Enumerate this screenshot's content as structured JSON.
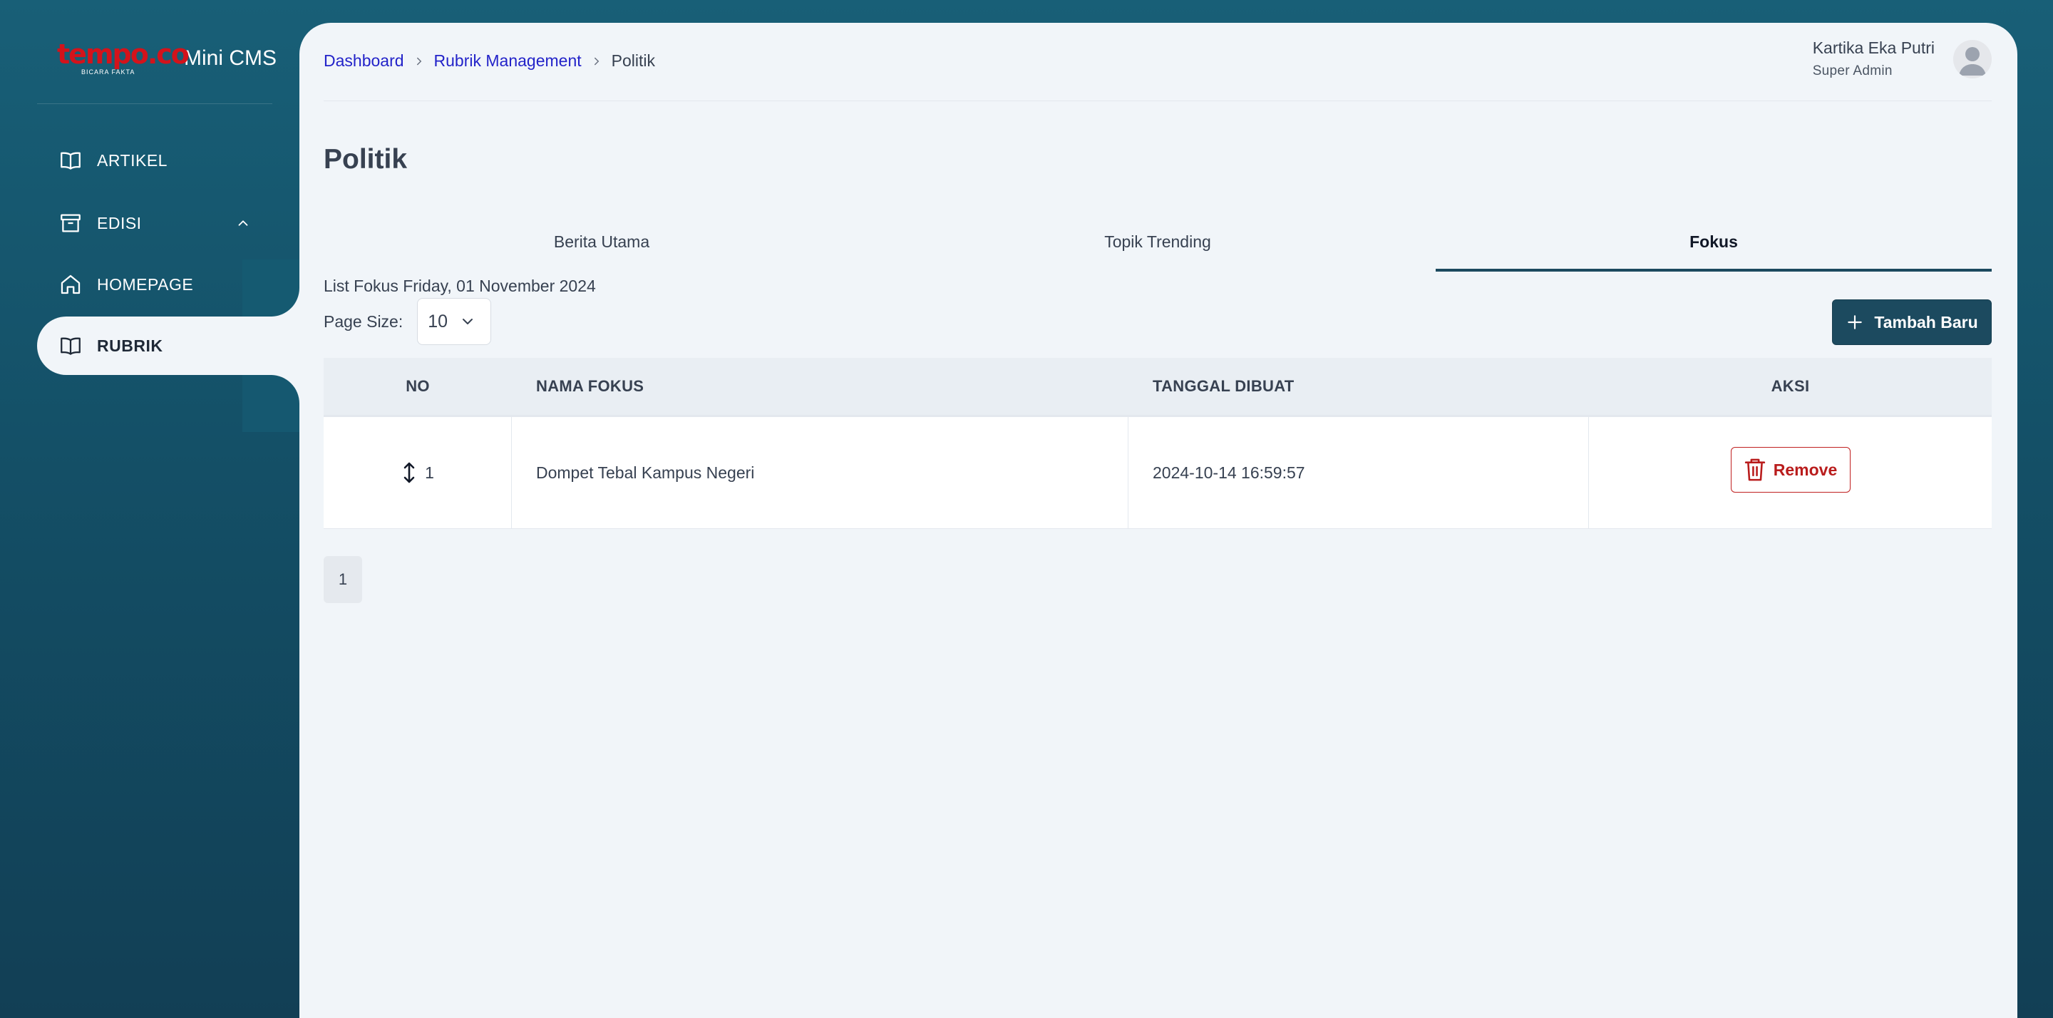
{
  "brand": {
    "logo_text": "tempo.co",
    "logo_tagline": "BICARA FAKTA",
    "app_name": "Mini CMS"
  },
  "sidebar": {
    "items": [
      {
        "label": "ARTIKEL",
        "icon": "book-open-icon"
      },
      {
        "label": "EDISI",
        "icon": "archive-box-icon",
        "expanded": true
      },
      {
        "label": "HOMEPAGE",
        "icon": "home-icon"
      },
      {
        "label": "RUBRIK",
        "icon": "book-open-icon",
        "active": true
      }
    ]
  },
  "breadcrumb": {
    "items": [
      "Dashboard",
      "Rubrik Management"
    ],
    "current": "Politik"
  },
  "user": {
    "name": "Kartika Eka Putri",
    "role": "Super Admin"
  },
  "page": {
    "title": "Politik"
  },
  "tabs": [
    {
      "label": "Berita Utama"
    },
    {
      "label": "Topik Trending"
    },
    {
      "label": "Fokus",
      "active": true
    }
  ],
  "list": {
    "caption": "List Fokus Friday, 01 November 2024",
    "page_size_label": "Page Size:",
    "page_size_value": "10",
    "add_button": "Tambah Baru"
  },
  "table": {
    "columns": [
      "NO",
      "NAMA FOKUS",
      "TANGGAL DIBUAT",
      "AKSI"
    ],
    "rows": [
      {
        "no": "1",
        "nama": "Dompet Tebal Kampus Negeri",
        "tanggal": "2024-10-14 16:59:57",
        "action": "Remove"
      }
    ]
  },
  "pagination": {
    "current": "1"
  },
  "colors": {
    "primary": "#1c4a5f",
    "danger": "#b91c1c",
    "link": "#2323c9",
    "sidebar_bg": "#185f77",
    "panel_bg": "#f1f5f9"
  }
}
